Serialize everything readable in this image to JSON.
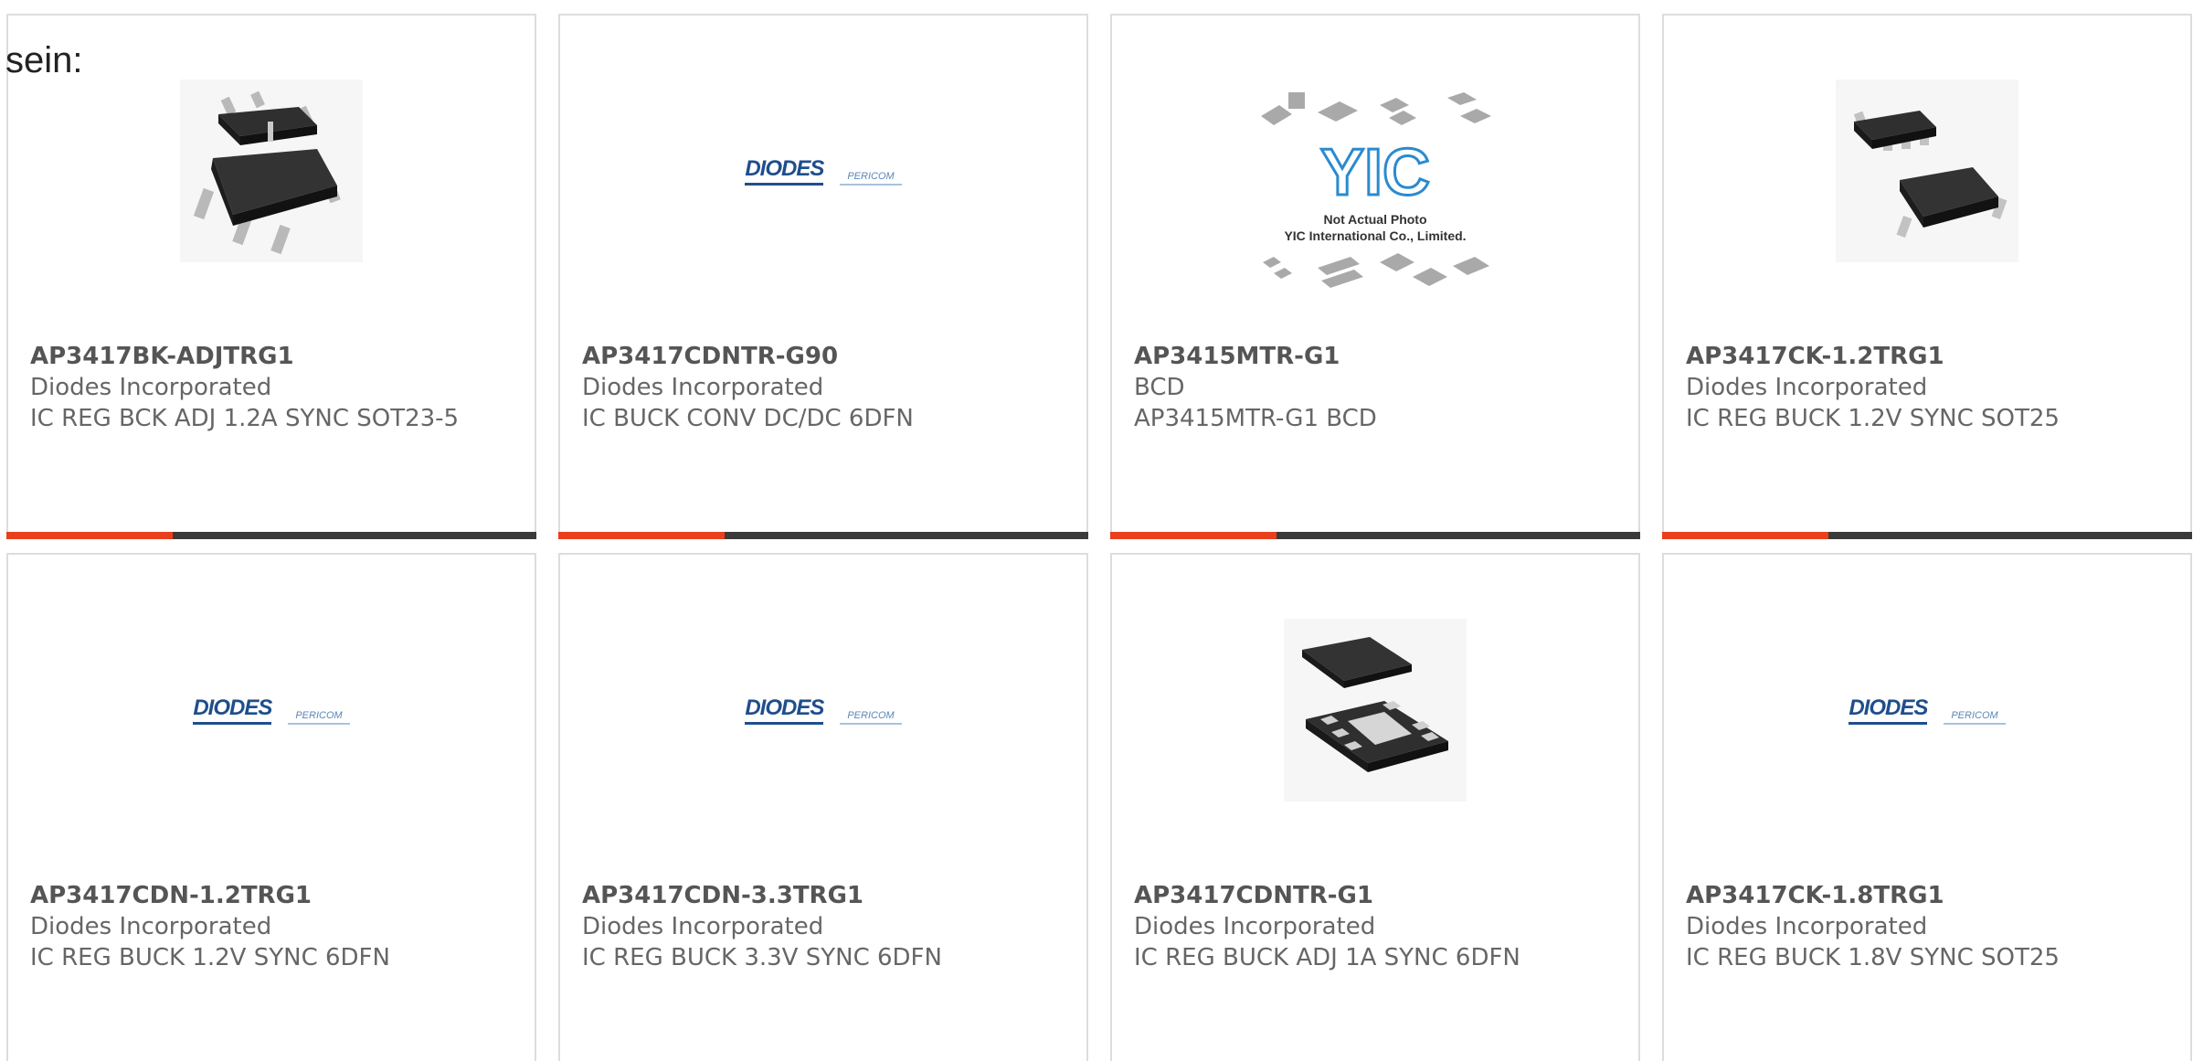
{
  "leading_text": "sein:",
  "colors": {
    "accent": "#e8401c",
    "bar": "#3a3a3a",
    "card_border": "#dddddd",
    "diodes_blue": "#1f4e8c",
    "yic_blue": "#2a8ad0"
  },
  "products": [
    {
      "part_number": "AP3417BK-ADJTRG1",
      "manufacturer": "Diodes Incorporated",
      "description": "IC REG BCK ADJ 1.2A SYNC SOT23-5",
      "image": "sot23-5-chip-icon"
    },
    {
      "part_number": "AP3417CDNTR-G90",
      "manufacturer": "Diodes Incorporated",
      "description": "IC BUCK CONV DC/DC 6DFN",
      "image": "diodes-pericom-logo"
    },
    {
      "part_number": "AP3415MTR-G1",
      "manufacturer": "BCD",
      "description": "AP3415MTR-G1 BCD",
      "image": "yic-placeholder",
      "image_text": {
        "logo": "YIC",
        "line1": "Not Actual Photo",
        "line2": "YIC International Co., Limited."
      }
    },
    {
      "part_number": "AP3417CK-1.2TRG1",
      "manufacturer": "Diodes Incorporated",
      "description": "IC REG BUCK 1.2V SYNC SOT25",
      "image": "sot25-chip-icon"
    },
    {
      "part_number": "AP3417CDN-1.2TRG1",
      "manufacturer": "Diodes Incorporated",
      "description": "IC REG BUCK 1.2V SYNC 6DFN",
      "image": "diodes-pericom-logo"
    },
    {
      "part_number": "AP3417CDN-3.3TRG1",
      "manufacturer": "Diodes Incorporated",
      "description": "IC REG BUCK 3.3V SYNC 6DFN",
      "image": "diodes-pericom-logo"
    },
    {
      "part_number": "AP3417CDNTR-G1",
      "manufacturer": "Diodes Incorporated",
      "description": "IC REG BUCK ADJ 1A SYNC 6DFN",
      "image": "dfn-chip-icon"
    },
    {
      "part_number": "AP3417CK-1.8TRG1",
      "manufacturer": "Diodes Incorporated",
      "description": "IC REG BUCK 1.8V SYNC SOT25",
      "image": "diodes-pericom-logo"
    }
  ],
  "logo_text": {
    "diodes": "DIODES",
    "pericom": "PERICOM"
  }
}
